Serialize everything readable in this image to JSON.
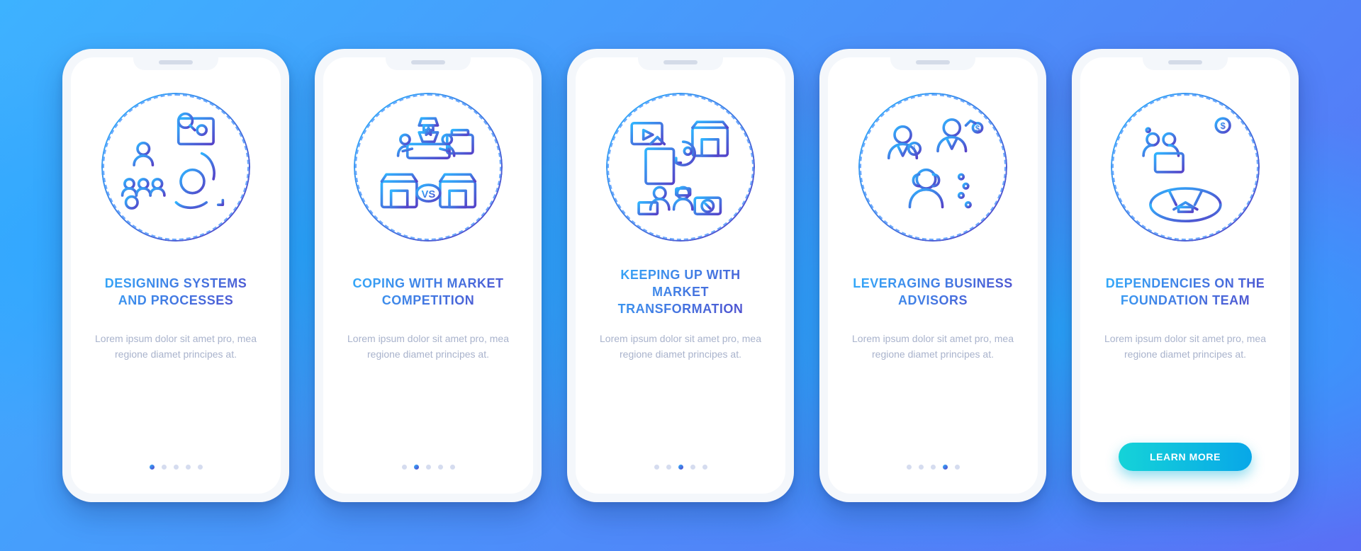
{
  "screens": [
    {
      "title": "DESIGNING SYSTEMS AND PROCESSES",
      "description": "Lorem ipsum dolor sit amet pro, mea regione diamet principes at.",
      "activeDot": 0,
      "illustration": "systems-processes-icon",
      "hasButton": false
    },
    {
      "title": "COPING WITH MARKET COMPETITION",
      "description": "Lorem ipsum dolor sit amet pro, mea regione diamet principes at.",
      "activeDot": 1,
      "illustration": "market-competition-icon",
      "hasButton": false
    },
    {
      "title": "KEEPING UP WITH MARKET TRANSFORMATION",
      "description": "Lorem ipsum dolor sit amet pro, mea regione diamet principes at.",
      "activeDot": 2,
      "illustration": "market-transformation-icon",
      "hasButton": false
    },
    {
      "title": "LEVERAGING BUSINESS ADVISORS",
      "description": "Lorem ipsum dolor sit amet pro, mea regione diamet principes at.",
      "activeDot": 3,
      "illustration": "business-advisors-icon",
      "hasButton": false
    },
    {
      "title": "DEPENDENCIES ON THE FOUNDATION TEAM",
      "description": "Lorem ipsum dolor sit amet pro, mea regione diamet principes at.",
      "activeDot": 4,
      "illustration": "foundation-team-icon",
      "hasButton": true
    }
  ],
  "dotCount": 5,
  "cta_label": "LEARN MORE",
  "colors": {
    "grad_start": "#2fb5ff",
    "grad_end": "#5542c8",
    "cta_start": "#15d3d8",
    "cta_end": "#08a7e8"
  }
}
